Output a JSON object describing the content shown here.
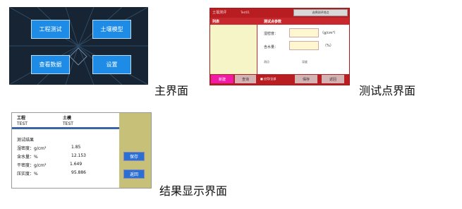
{
  "main_screen": {
    "buttons": [
      "工程测试",
      "土壤模型",
      "查看数据",
      "设置"
    ]
  },
  "point_screen": {
    "header_title": "土壤测评",
    "header_mode": "Test01",
    "header_button": "选择测评地点",
    "list_header": "列表",
    "param_header": "测试点参数",
    "density_label": "湿密度：",
    "density_unit": "（g/cm³）",
    "moisture_label": "含水量：",
    "moisture_unit": "（%）",
    "extra_label_1": "测点",
    "extra_label_2": "深度",
    "bottom_buttons": {
      "new": "新建",
      "query": "查询",
      "apply": "■ 应用/全部",
      "save": "保存",
      "back": "返回"
    }
  },
  "result_screen": {
    "header": {
      "col1": "工程",
      "col2": "土模",
      "val1": "TEST",
      "val2": "TEST"
    },
    "section_title": "测试结果",
    "rows": [
      {
        "label": "湿密度：g/cm³",
        "value": "1.85"
      },
      {
        "label": "含水量：%",
        "value": "12.153"
      },
      {
        "label": "干密度：g/cm³",
        "value": "1.649"
      },
      {
        "label": "压实度：%",
        "value": "95.886"
      }
    ],
    "buttons": {
      "save": "保存",
      "back": "返回"
    }
  },
  "captions": {
    "main": "主界面",
    "point": "测试点界面",
    "result": "结果显示界面"
  }
}
